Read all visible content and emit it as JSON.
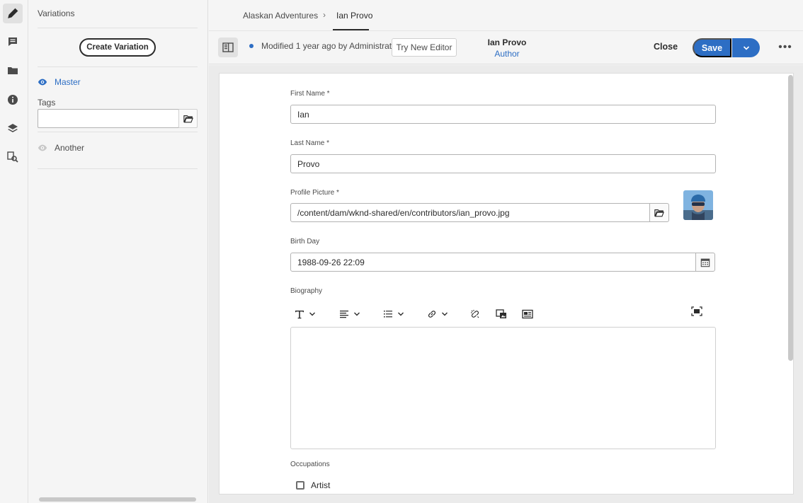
{
  "rail": {
    "items": [
      {
        "icon": "edit-icon",
        "active": true
      },
      {
        "icon": "annotate-icon"
      },
      {
        "icon": "folder-icon"
      },
      {
        "icon": "info-icon"
      },
      {
        "icon": "layers-icon"
      },
      {
        "icon": "references-search-icon"
      }
    ]
  },
  "variations": {
    "title": "Variations",
    "create_label": "Create Variation",
    "master_label": "Master",
    "tags_label": "Tags",
    "tags_value": "",
    "another_label": "Another"
  },
  "breadcrumb": {
    "parent": "Alaskan Adventures",
    "separator": "›",
    "current": "Ian Provo"
  },
  "toolbar": {
    "modified_text": "Modified 1 year ago by Administrator",
    "try_label": "Try New Editor",
    "doc_title": "Ian Provo",
    "doc_model": "Author",
    "close_label": "Close",
    "save_label": "Save",
    "more_label": "•••"
  },
  "form": {
    "first_name": {
      "label": "First Name *",
      "value": "Ian"
    },
    "last_name": {
      "label": "Last Name *",
      "value": "Provo"
    },
    "profile_picture": {
      "label": "Profile Picture *",
      "value": "/content/dam/wknd-shared/en/contributors/ian_provo.jpg"
    },
    "birth_day": {
      "label": "Birth Day",
      "value": "1988-09-26 22:09"
    },
    "biography": {
      "label": "Biography",
      "value": ""
    },
    "occupations": {
      "label": "Occupations",
      "options": [
        {
          "label": "Artist",
          "checked": false
        }
      ]
    }
  },
  "colors": {
    "accent": "#2d6ec4",
    "text": "#2c2c2c",
    "background": "#f5f5f5"
  }
}
